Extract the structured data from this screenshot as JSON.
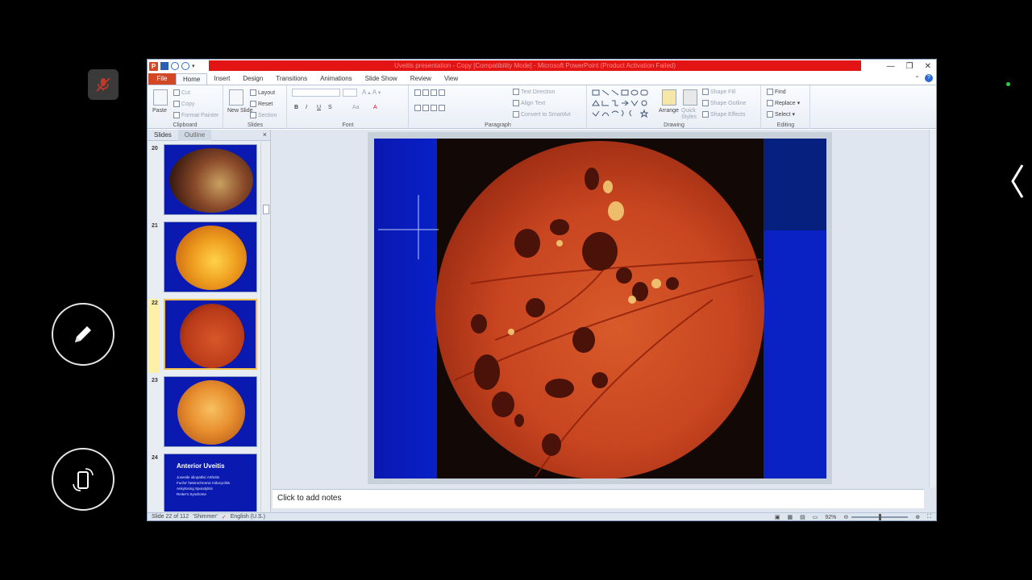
{
  "window": {
    "title": "Uveitis presentation - Copy [Compatibility Mode] - Microsoft PowerPoint (Product Activation Failed)",
    "title_color": "#e31414"
  },
  "ribbon_tabs": [
    "File",
    "Home",
    "Insert",
    "Design",
    "Transitions",
    "Animations",
    "Slide Show",
    "Review",
    "View"
  ],
  "ribbon": {
    "clipboard": {
      "paste": "Paste",
      "cut": "Cut",
      "copy": "Copy",
      "format_painter": "Format Painter",
      "label": "Clipboard"
    },
    "slides": {
      "new_slide": "New Slide",
      "layout": "Layout",
      "reset": "Reset",
      "section": "Section",
      "label": "Slides"
    },
    "font": {
      "label": "Font",
      "bold": "B",
      "italic": "I",
      "underline": "U",
      "strike": "S",
      "aa": "Aa"
    },
    "paragraph": {
      "text_direction": "Text Direction",
      "align_text": "Align Text",
      "smartart": "Convert to SmartArt",
      "label": "Paragraph"
    },
    "drawing": {
      "arrange": "Arrange",
      "quick_styles": "Quick Styles",
      "shape_fill": "Shape Fill",
      "shape_outline": "Shape Outline",
      "shape_effects": "Shape Effects",
      "label": "Drawing"
    },
    "editing": {
      "find": "Find",
      "replace": "Replace",
      "select": "Select",
      "label": "Editing"
    }
  },
  "slides_panel": {
    "tab_slides": "Slides",
    "tab_outline": "Outline",
    "close": "×",
    "thumbnails": [
      {
        "number": "20"
      },
      {
        "number": "21"
      },
      {
        "number": "22"
      },
      {
        "number": "23"
      },
      {
        "number": "24",
        "title": "Anterior Uveitis",
        "bullets": [
          "Juvenile idiopathic Arthritis",
          "Fuchs' heterochromic Iridocyclitis",
          "Ankylosing Spondylitis",
          "Reiter's Syndrome"
        ]
      }
    ]
  },
  "notes": {
    "placeholder": "Click to add notes"
  },
  "status": {
    "slide_info": "Slide 22 of 112",
    "theme": "'Shimmer'",
    "language": "English (U.S.)",
    "zoom": "92%"
  },
  "colors": {
    "slide_bg": "#0b18a6",
    "fundus": "#c9461f",
    "file_tab": "#d24726"
  }
}
